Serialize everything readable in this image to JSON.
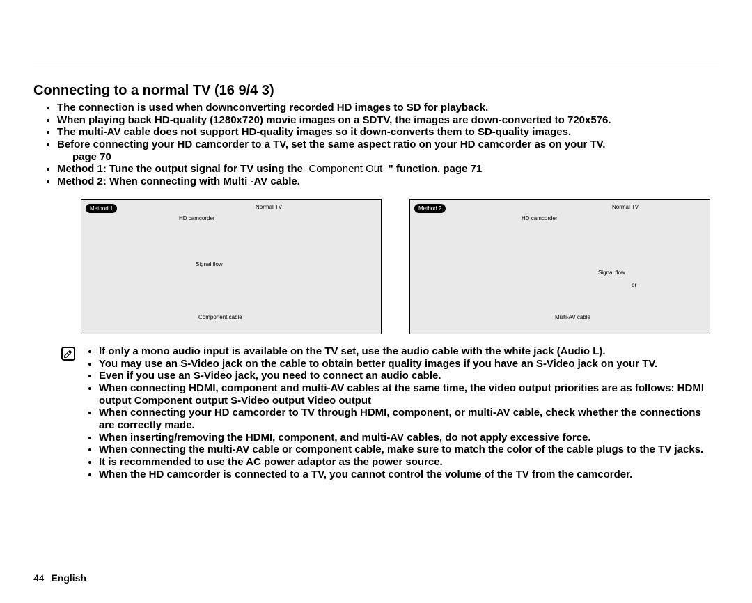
{
  "title": "Connecting to a normal TV (16   9/4   3)",
  "bullets": [
    {
      "text": "The connection is used when downconverting recorded HD images to SD for playback."
    },
    {
      "text": "When playing back HD-quality (1280x720) movie images on a SDTV, the images are down-converted to 720x576."
    },
    {
      "text": "The multi-AV cable does not support HD-quality images so it down-converts them to SD-quality images."
    },
    {
      "text": "Before connecting your HD camcorder to a TV, set the same aspect ratio on your HD camcorder as on your TV.",
      "suffix_indent": "page 70"
    },
    {
      "prefix": "Method 1: Tune the output signal for TV using the",
      "light": "Component Out",
      "suffix": "\" function.   page 71"
    },
    {
      "text": "Method 2: When connecting with Multi -AV cable."
    }
  ],
  "diagram1": {
    "badge": "Method 1",
    "normal_tv": "Normal TV",
    "hd": "HD camcorder",
    "signal": "Signal flow",
    "cable": "Component cable"
  },
  "diagram2": {
    "badge": "Method 2",
    "normal_tv": "Normal TV",
    "hd": "HD camcorder",
    "signal": "Signal flow",
    "or": "or",
    "cable": "Multi-AV cable"
  },
  "notes": [
    "If only a mono audio input is available on the TV set, use the audio cable with the white jack (Audio L).",
    "You may use an S-Video jack on the cable to obtain better quality images if you have an S-Video jack on your TV.",
    "Even if you use an S-Video jack, you need to connect an audio cable.",
    "When connecting HDMI, component and multi-AV cables at the same time, the video output priorities are as follows: HDMI output   Component output   S-Video output    Video output",
    "When connecting your HD camcorder to TV through HDMI, component, or multi-AV cable, check whether the connections are correctly made.",
    "When inserting/removing the HDMI, component, and multi-AV cables, do not apply excessive force.",
    "When connecting the multi-AV cable or component cable, make sure to match the color of the cable plugs to the TV jacks.",
    "It is recommended to use the AC power adaptor as the power source.",
    "When the HD camcorder is connected to a TV, you cannot control the volume of the TV from the camcorder."
  ],
  "footer": {
    "page_num": "44",
    "lang": "English"
  }
}
